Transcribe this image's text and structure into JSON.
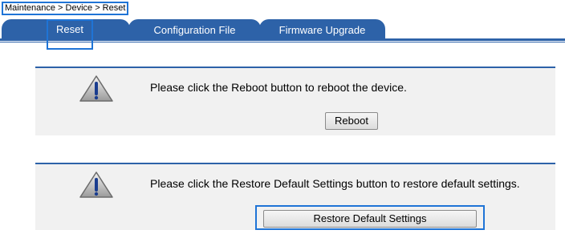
{
  "breadcrumb": "Maintenance > Device > Reset",
  "tabs": [
    {
      "label": "Reset"
    },
    {
      "label": "Configuration File"
    },
    {
      "label": "Firmware Upgrade"
    }
  ],
  "reboot": {
    "message": "Please click the Reboot button to reboot the device.",
    "button_label": "Reboot",
    "icon": "warning-icon"
  },
  "restore": {
    "message": "Please click the Restore Default Settings button to restore default settings.",
    "button_label": "Restore Default Settings",
    "icon": "warning-icon"
  },
  "colors": {
    "accent": "#2d62a8",
    "highlight": "#1f74d6",
    "panel_bg": "#f1f1f1"
  }
}
